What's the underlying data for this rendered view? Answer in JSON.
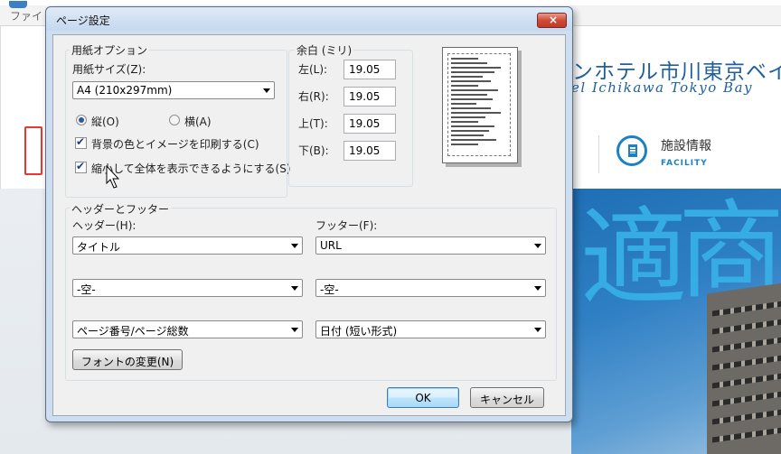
{
  "browser": {
    "menu_label": "ファイ",
    "logo_jp": "ンホテル市川東京ベイ",
    "logo_en": "el Ichikawa Tokyo Bay",
    "facility_label": "施設情報",
    "facility_sub": "FACILITY",
    "hero_text_1": "適",
    "hero_text_2": "商"
  },
  "dialog": {
    "title": "ページ設定",
    "close_label": "×",
    "paper": {
      "group_label": "用紙オプション",
      "size_label": "用紙サイズ(Z):",
      "size_value": "A4 (210x297mm)",
      "portrait_label": "縦(O)",
      "landscape_label": "横(A)",
      "orientation_selected": "portrait",
      "print_bg_label": "背景の色とイメージを印刷する(C)",
      "print_bg_checked": true,
      "shrink_label": "縮小して全体を表示できるようにする(S)",
      "shrink_checked": true
    },
    "margins": {
      "group_label": "余白 (ミリ)",
      "left_label": "左(L):",
      "left_value": "19.05",
      "right_label": "右(R):",
      "right_value": "19.05",
      "top_label": "上(T):",
      "top_value": "19.05",
      "bottom_label": "下(B):",
      "bottom_value": "19.05"
    },
    "header_footer": {
      "group_label": "ヘッダーとフッター",
      "header_label": "ヘッダー(H):",
      "footer_label": "フッター(F):",
      "header_values": [
        "タイトル",
        "-空-",
        "ページ番号/ページ総数"
      ],
      "footer_values": [
        "URL",
        "-空-",
        "日付 (短い形式)"
      ],
      "font_button": "フォントの変更(N)"
    },
    "ok_label": "OK",
    "cancel_label": "キャンセル"
  },
  "colors": {
    "accent": "#1a82c4",
    "logo": "#1f5f9e",
    "highlight": "#e33333"
  }
}
